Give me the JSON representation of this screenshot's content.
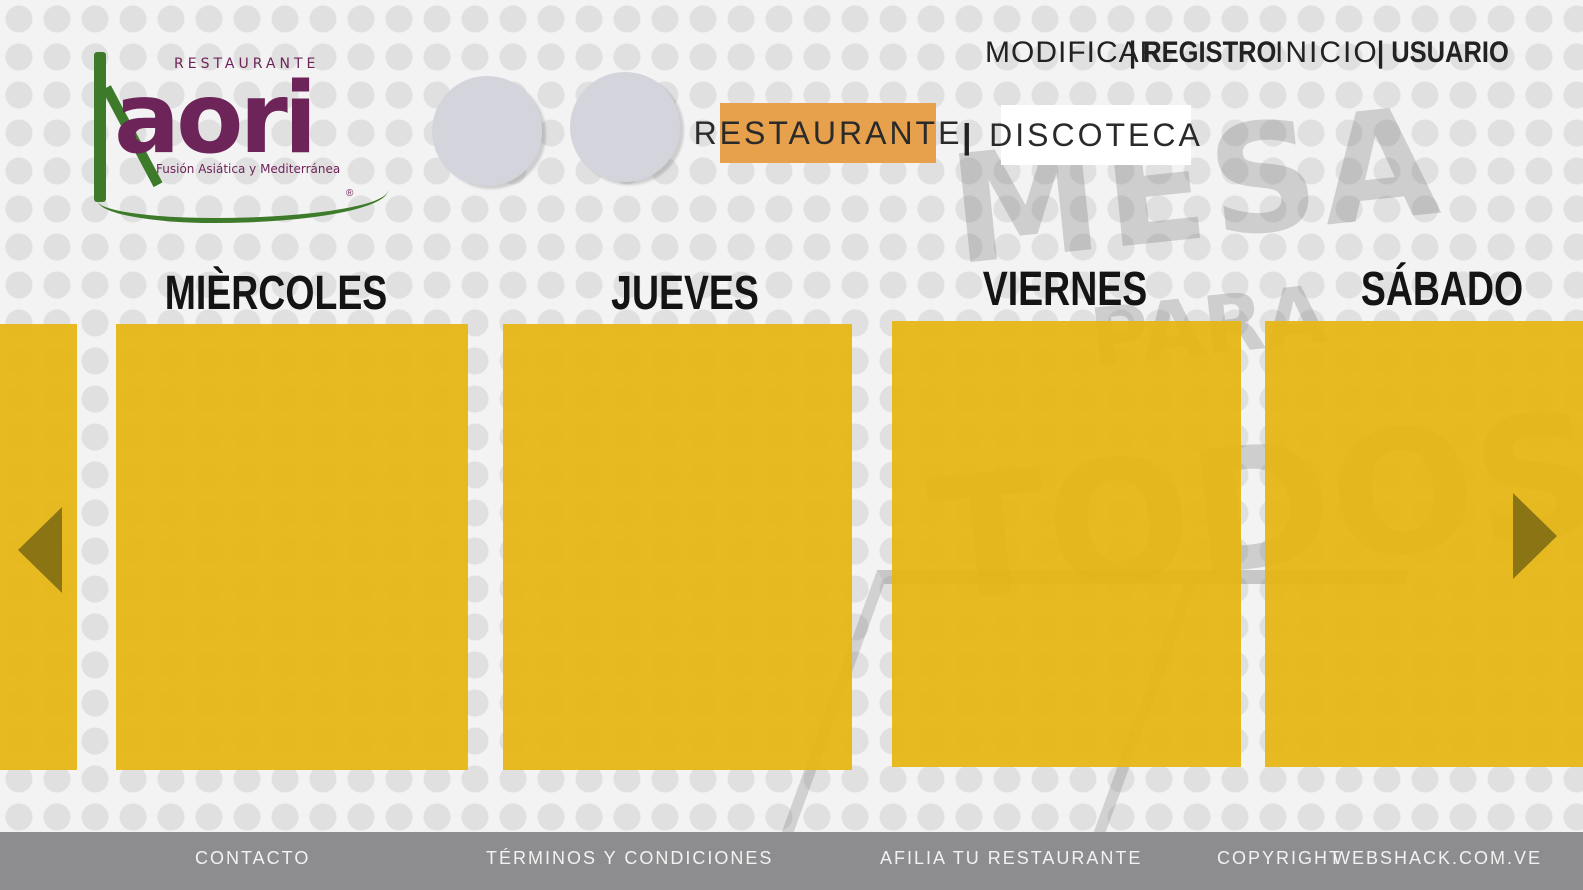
{
  "logo": {
    "top_text": "RESTAURANTE",
    "brand": "aori",
    "subtitle": "Fusión Asiática y Mediterránea",
    "registered": "®"
  },
  "watermark": {
    "line1": "MESA",
    "line2": "PARA",
    "line3": "TODOS"
  },
  "nav": {
    "modificar": "MODIFICAR",
    "registro": "| REGISTRO",
    "inicio": "INICIO",
    "usuario": "| USUARIO"
  },
  "modes": {
    "restaurante": "RESTAURANTE",
    "separator": "|",
    "discoteca": "DISCOTECA"
  },
  "days": [
    "MIÈRCOLES",
    "JUEVES",
    "VIERNES",
    "SÁBADO"
  ],
  "footer": {
    "contacto": "CONTACTO",
    "terminos": "TÉRMINOS Y CONDICIONES",
    "afilia": "AFILIA TU RESTAURANTE",
    "copyright": "COPYRIGHT",
    "web": "WEBSHACK.COM.VE"
  },
  "colors": {
    "panel": "#e5b614",
    "restaurante_button": "#e7a04b",
    "footer": "#8d8d8f",
    "brand_purple": "#6d2459",
    "brand_green": "#3d7b2a"
  }
}
